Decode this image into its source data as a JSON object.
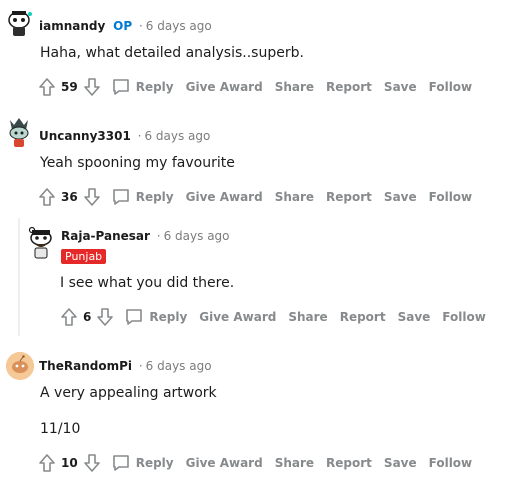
{
  "comments": [
    {
      "username": "iamnandy",
      "op_badge": "OP",
      "separator": "·",
      "time": "6 days ago",
      "text": "Haha, what detailed analysis..superb.",
      "votes": "59",
      "actions": {
        "reply": "Reply",
        "award": "Give Award",
        "share": "Share",
        "report": "Report",
        "save": "Save",
        "follow": "Follow"
      }
    },
    {
      "username": "Uncanny3301",
      "separator": "·",
      "time": "6 days ago",
      "text": "Yeah spooning my favourite",
      "votes": "36",
      "actions": {
        "reply": "Reply",
        "award": "Give Award",
        "share": "Share",
        "report": "Report",
        "save": "Save",
        "follow": "Follow"
      }
    },
    {
      "username": "Raja-Panesar",
      "separator": "·",
      "time": "6 days ago",
      "flair": "Punjab",
      "text": "I see what you did there.",
      "votes": "6",
      "actions": {
        "reply": "Reply",
        "award": "Give Award",
        "share": "Share",
        "report": "Report",
        "save": "Save",
        "follow": "Follow"
      }
    },
    {
      "username": "TheRandomPi",
      "separator": "·",
      "time": "6 days ago",
      "text": "A very appealing artwork",
      "text2": "11/10",
      "votes": "10",
      "actions": {
        "reply": "Reply",
        "award": "Give Award",
        "share": "Share",
        "report": "Report",
        "save": "Save",
        "follow": "Follow"
      }
    }
  ],
  "colors": {
    "op": "#0079d3",
    "flair": "#e52929",
    "action": "#878a8c"
  }
}
